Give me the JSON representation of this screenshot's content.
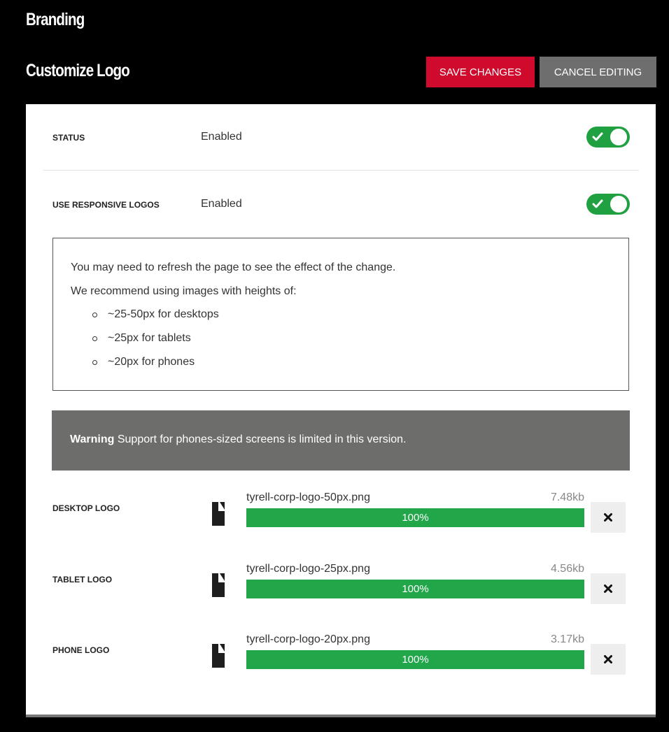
{
  "header": {
    "title": "Branding"
  },
  "section": {
    "title": "Customize Logo",
    "save_label": "SAVE CHANGES",
    "cancel_label": "CANCEL EDITING"
  },
  "colors": {
    "save_button": "#cf0a2c",
    "cancel_button": "#6e6e6e",
    "toggle_on": "#1fa142",
    "progress_fill": "#21a64a",
    "warning_bg": "#6d6d6b"
  },
  "settings": {
    "status": {
      "label": "STATUS",
      "value": "Enabled",
      "toggle_on": true,
      "toggle_icon": "check-icon"
    },
    "responsive": {
      "label": "USE RESPONSIVE LOGOS",
      "value": "Enabled",
      "toggle_on": true,
      "toggle_icon": "check-icon"
    }
  },
  "info": {
    "line1": "You may need to refresh the page to see the effect of the change.",
    "line2": "We recommend using images with heights of:",
    "items": [
      "~25-50px for desktops",
      "~25px for tablets",
      "~20px for phones"
    ]
  },
  "warning": {
    "strong": "Warning",
    "text": "Support for phones-sized screens is limited in this version."
  },
  "logos": [
    {
      "label": "DESKTOP LOGO",
      "file_name": "tyrell-corp-logo-50px.png",
      "file_size": "7.48kb",
      "progress_text": "100%",
      "progress": 1.0,
      "icon": "file-icon",
      "remove_icon": "close-icon"
    },
    {
      "label": "TABLET LOGO",
      "file_name": "tyrell-corp-logo-25px.png",
      "file_size": "4.56kb",
      "progress_text": "100%",
      "progress": 1.0,
      "icon": "file-icon",
      "remove_icon": "close-icon"
    },
    {
      "label": "PHONE LOGO",
      "file_name": "tyrell-corp-logo-20px.png",
      "file_size": "3.17kb",
      "progress_text": "100%",
      "progress": 1.0,
      "icon": "file-icon",
      "remove_icon": "close-icon"
    }
  ]
}
